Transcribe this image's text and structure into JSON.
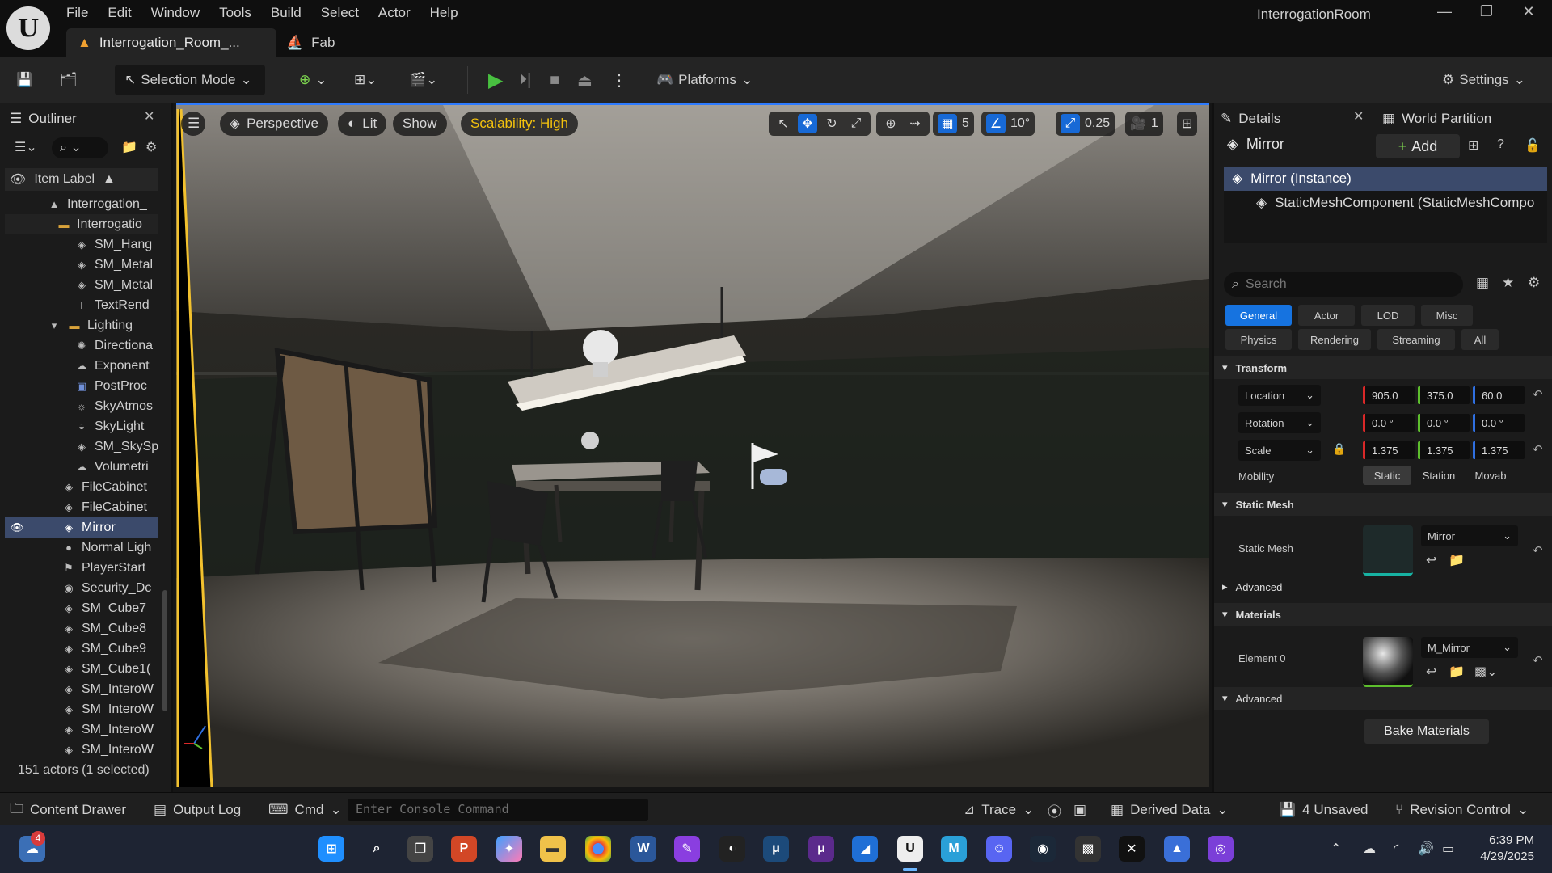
{
  "menu": [
    "File",
    "Edit",
    "Window",
    "Tools",
    "Build",
    "Select",
    "Actor",
    "Help"
  ],
  "window": {
    "title": "InterrogationRoom"
  },
  "tabs": {
    "level": "Interrogation_Room_...",
    "fab": "Fab"
  },
  "toolbar": {
    "mode": "Selection Mode",
    "platforms": "Platforms",
    "settings": "Settings"
  },
  "outliner": {
    "title": "Outliner",
    "column": "Item Label",
    "items": [
      "Interrogation_",
      "Interrogatio",
      "SM_Hang",
      "SM_Metal",
      "SM_Metal",
      "TextRend",
      "Lighting",
      "Directiona",
      "Exponent",
      "PostProc",
      "SkyAtmos",
      "SkyLight",
      "SM_SkySp",
      "Volumetri",
      "FileCabinet",
      "FileCabinet",
      "Mirror",
      "Normal Ligh",
      "PlayerStart",
      "Security_Dc",
      "SM_Cube7",
      "SM_Cube8",
      "SM_Cube9",
      "SM_Cube1(",
      "SM_InteroW",
      "SM_InteroW",
      "SM_InteroW",
      "SM_InteroW"
    ],
    "status": "151 actors (1 selected)"
  },
  "viewport": {
    "perspective": "Perspective",
    "lit": "Lit",
    "show": "Show",
    "scalability": "Scalability: High",
    "grid": "5",
    "rotation_snap": "10°",
    "scale_snap": "0.25",
    "camera_speed": "1"
  },
  "details": {
    "tab": "Details",
    "tab2": "World Partition",
    "actor": "Mirror",
    "add": "Add",
    "components": [
      "Mirror (Instance)",
      "StaticMeshComponent (StaticMeshCompo"
    ],
    "search_placeholder": "Search",
    "filters": [
      "General",
      "Actor",
      "LOD",
      "Misc",
      "Physics",
      "Rendering",
      "Streaming",
      "All"
    ],
    "transform_title": "Transform",
    "location_label": "Location",
    "rotation_label": "Rotation",
    "scale_label": "Scale",
    "location": [
      "905.0",
      "375.0",
      "60.0"
    ],
    "rotation": [
      "0.0 °",
      "0.0 °",
      "0.0 °"
    ],
    "scale": [
      "1.375",
      "1.375",
      "1.375"
    ],
    "mobility_label": "Mobility",
    "mobility": [
      "Static",
      "Station",
      "Movab"
    ],
    "static_mesh_title": "Static Mesh",
    "static_mesh_label": "Static Mesh",
    "static_mesh_value": "Mirror",
    "advanced": "Advanced",
    "materials_title": "Materials",
    "element_label": "Element 0",
    "material_value": "M_Mirror",
    "advanced2": "Advanced",
    "bake": "Bake Materials"
  },
  "statusbar": {
    "content_drawer": "Content Drawer",
    "output_log": "Output Log",
    "cmd": "Cmd",
    "console_placeholder": "Enter Console Command",
    "trace": "Trace",
    "derived_data": "Derived Data",
    "unsaved": "4 Unsaved",
    "revision": "Revision Control"
  },
  "taskbar": {
    "time": "6:39 PM",
    "date": "4/29/2025",
    "badge": "4"
  }
}
